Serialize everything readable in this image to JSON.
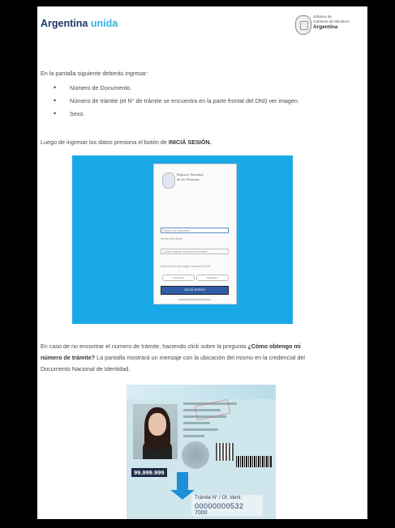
{
  "header": {
    "brand_main": "Argentina",
    "brand_accent": "unida",
    "ministry_line1": "Jefatura de",
    "ministry_line2": "Gabinete de Ministros",
    "ministry_country": "Argentina"
  },
  "intro": "En la pantalla siguiente deberás ingresar:",
  "bullets": [
    "Número de Documento.",
    "Número de trámite (el N° de trámite se encuentra en la parte frontal del DNI) ver imagen.",
    "Sexo."
  ],
  "after_login": {
    "before": "Luego de ingresar los datos presiona el botón de ",
    "emphasis": "INICIÁ SESIÓN."
  },
  "login_mock": {
    "title_line1": "Registro Nacional",
    "title_line2": "de las Personas",
    "subtitle": "",
    "field1": "Número de Documento",
    "label_tramite": "Número de trámite",
    "field2": "¿Cómo obtengo mi número de trámite?",
    "label_sexo": "Seleccioná el sexo según consta en tu DNI",
    "pill_left": "Femenino",
    "pill_right": "Masculino",
    "button": "INICIÁ SESIÓN"
  },
  "not_found": {
    "line1_before": "En caso de no encontrar el número de trámite, haciendo click sobre la pregunta ",
    "line1_bold": "¿Cómo obtengo mi",
    "line2_bold": "número de trámite?",
    "line2_after": " La pantalla mostrará un mensaje con la ubicación del mismo en la credencial del",
    "line3": "Documento Nacional de Identidad."
  },
  "dni_card": {
    "document_number": "99.999.999",
    "tramite_label": "Trámite N° / Of. Ident.",
    "tramite_number": "00000000532",
    "tramite_extra": "7000"
  }
}
